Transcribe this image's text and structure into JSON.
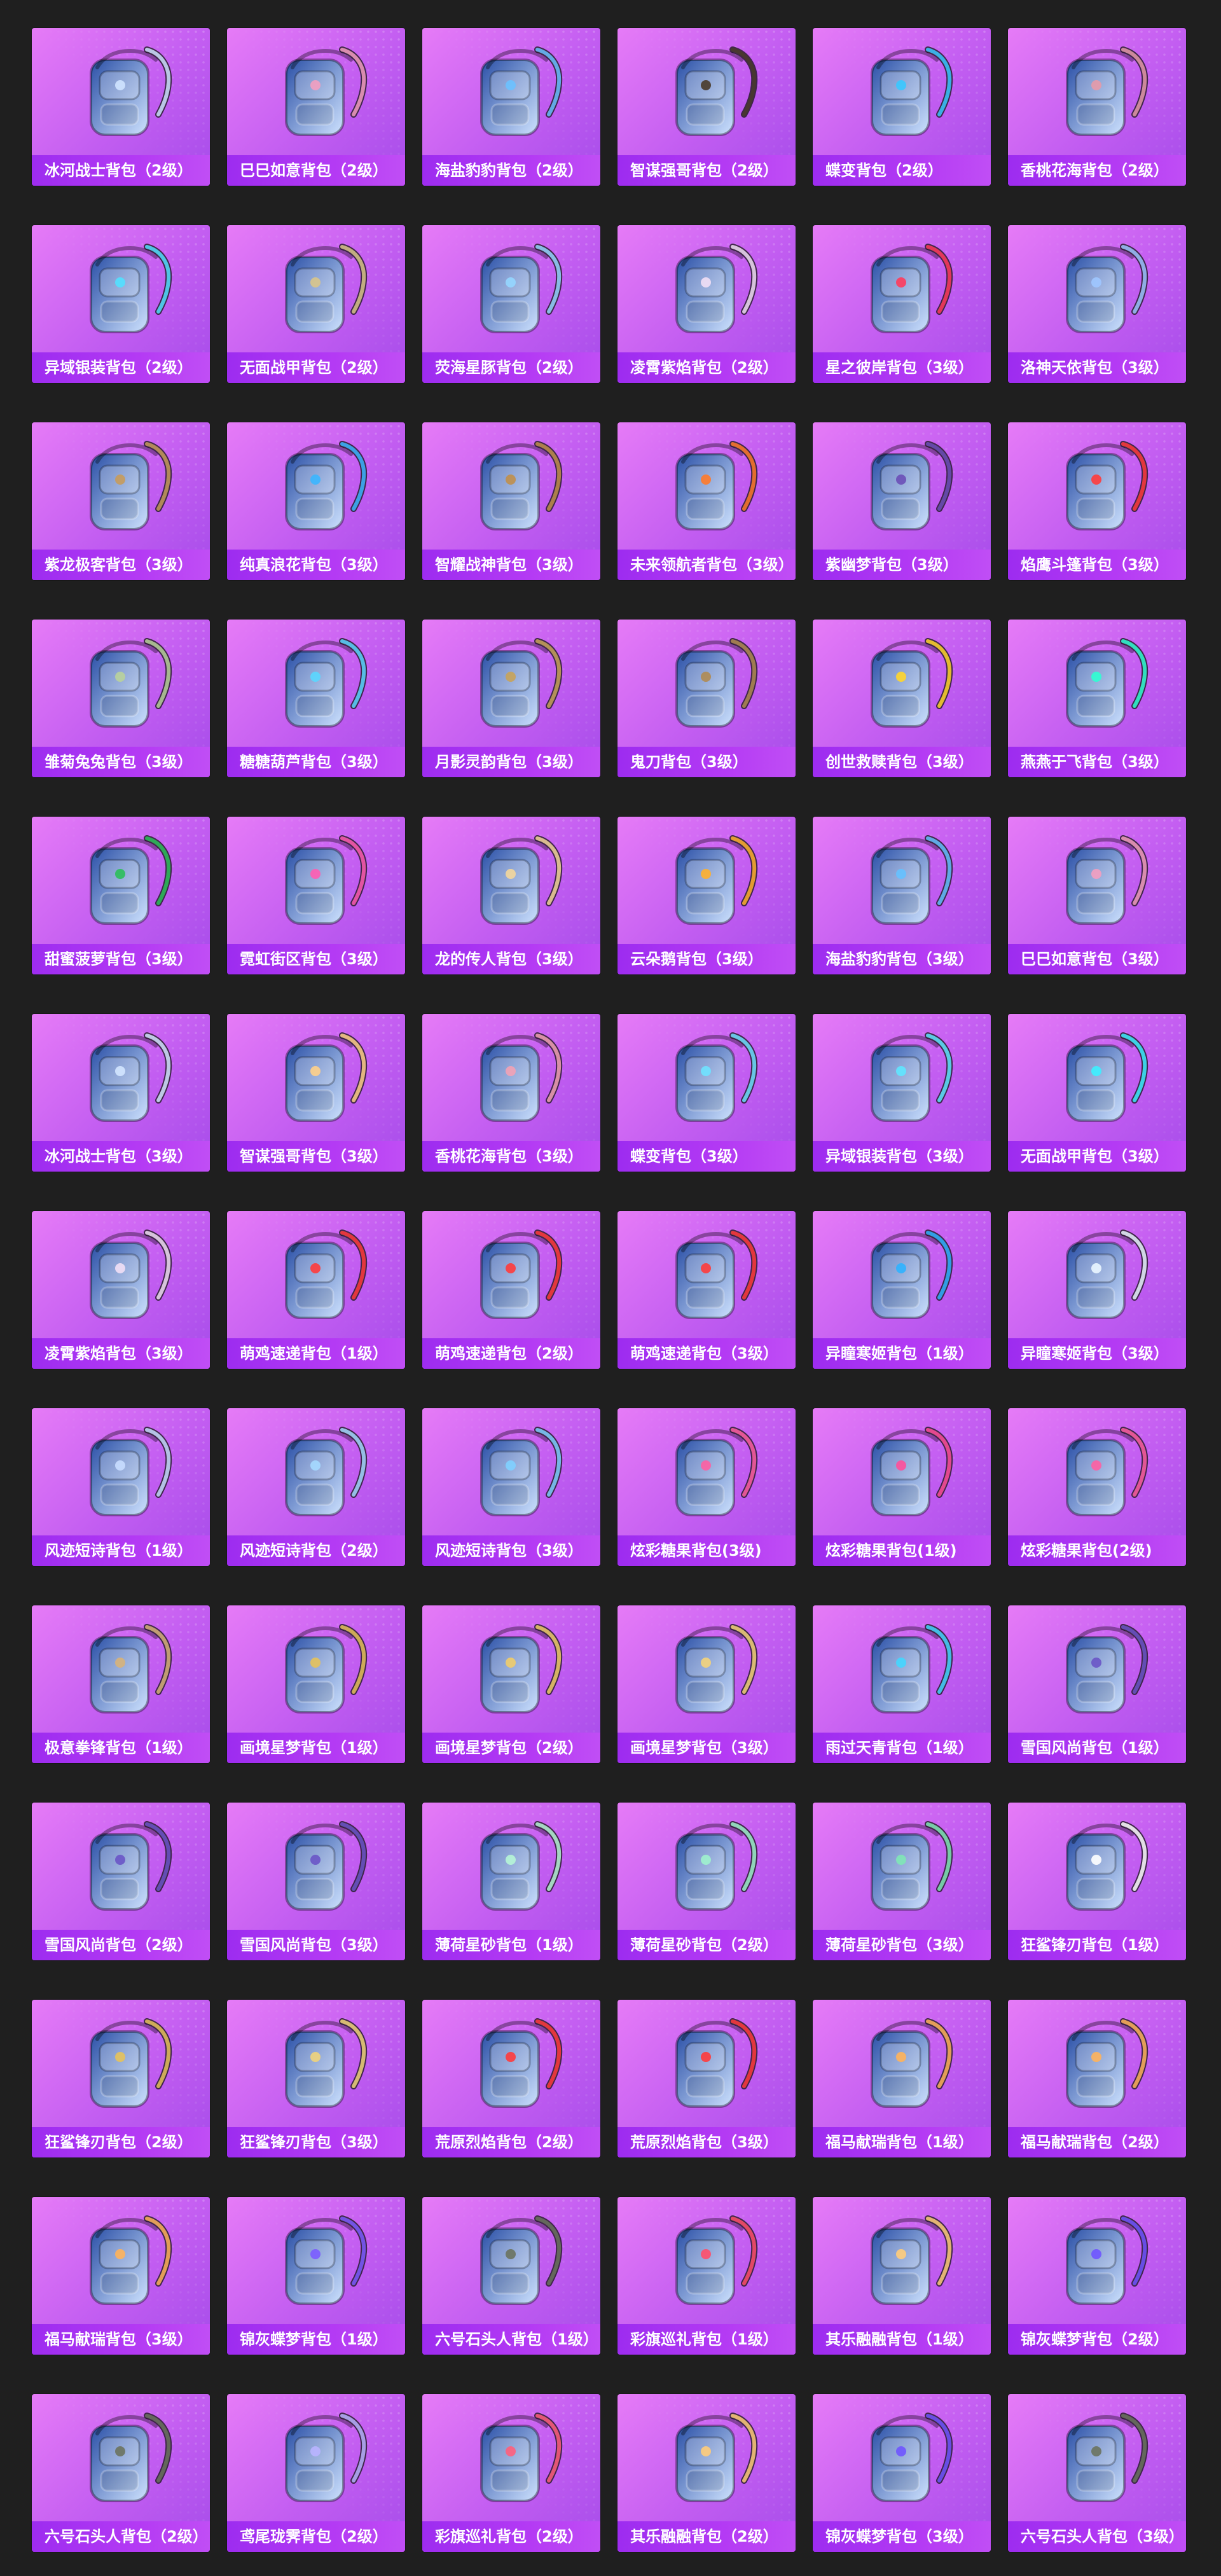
{
  "items": [
    {
      "label": "冰河战士背包（2级）",
      "icon": "backpack-icon",
      "colors": [
        "#2a4fa6",
        "#cfe3ff"
      ]
    },
    {
      "label": "巳巳如意背包（2级）",
      "icon": "backpack-icon",
      "colors": [
        "#f7e9ef",
        "#f39fc0"
      ]
    },
    {
      "label": "海盐豹豹背包（2级）",
      "icon": "backpack-icon",
      "colors": [
        "#eaf6ff",
        "#6ac1ff"
      ]
    },
    {
      "label": "智谋强哥背包（2级）",
      "icon": "backpack-icon",
      "colors": [
        "#d7a55a",
        "#4a3b2b"
      ]
    },
    {
      "label": "蝶变背包（2级）",
      "icon": "backpack-icon",
      "colors": [
        "#1d1f29",
        "#39c8ff"
      ]
    },
    {
      "label": "香桃花海背包（2级）",
      "icon": "backpack-icon",
      "colors": [
        "#fbe4ea",
        "#e59aa9"
      ]
    },
    {
      "label": "异域银装背包（2级）",
      "icon": "backpack-icon",
      "colors": [
        "#243039",
        "#52e0ff"
      ]
    },
    {
      "label": "无面战甲背包（2级）",
      "icon": "backpack-icon",
      "colors": [
        "#1b1b22",
        "#d9c58a"
      ]
    },
    {
      "label": "荧海星豚背包（2级）",
      "icon": "backpack-icon",
      "colors": [
        "#dff5ff",
        "#95d6ff"
      ]
    },
    {
      "label": "凌霄紫焰背包（2级）",
      "icon": "backpack-icon",
      "colors": [
        "#b89cc6",
        "#f1dff5"
      ]
    },
    {
      "label": "星之彼岸背包（3级）",
      "icon": "backpack-icon",
      "colors": [
        "#2b1f3f",
        "#ff3b5c"
      ]
    },
    {
      "label": "洛神天依背包（3级）",
      "icon": "backpack-icon",
      "colors": [
        "#dff3ff",
        "#9ec6ff"
      ]
    },
    {
      "label": "紫龙极客背包（3级）",
      "icon": "backpack-icon",
      "colors": [
        "#2a2222",
        "#c69b5c"
      ]
    },
    {
      "label": "纯真浪花背包（3级）",
      "icon": "backpack-icon",
      "colors": [
        "#ffe15a",
        "#3bb6ff"
      ]
    },
    {
      "label": "智耀战神背包（3级）",
      "icon": "backpack-icon",
      "colors": [
        "#f7efe4",
        "#c08f4b"
      ]
    },
    {
      "label": "未来领航者背包（3级）",
      "icon": "backpack-icon",
      "colors": [
        "#414958",
        "#ff7a2a"
      ]
    },
    {
      "label": "紫幽梦背包（3级）",
      "icon": "backpack-icon",
      "colors": [
        "#c6a8ff",
        "#6b4fb7"
      ]
    },
    {
      "label": "焰鹰斗篷背包（3级）",
      "icon": "backpack-icon",
      "colors": [
        "#3b0f18",
        "#ff3b3b"
      ]
    },
    {
      "label": "雏菊兔兔背包（3级）",
      "icon": "backpack-icon",
      "colors": [
        "#eef1df",
        "#b9d19b"
      ]
    },
    {
      "label": "糖糖葫芦背包（3级）",
      "icon": "backpack-icon",
      "colors": [
        "#ffb6b6",
        "#5ad7ff"
      ]
    },
    {
      "label": "月影灵韵背包（3级）",
      "icon": "backpack-icon",
      "colors": [
        "#e7e1d6",
        "#c8a35a"
      ]
    },
    {
      "label": "鬼刀背包（3级）",
      "icon": "backpack-icon",
      "colors": [
        "#f4ead7",
        "#b08b52"
      ]
    },
    {
      "label": "创世救赎背包（3级）",
      "icon": "backpack-icon",
      "colors": [
        "#1b1b1b",
        "#ffd52b"
      ]
    },
    {
      "label": "燕燕于飞背包（3级）",
      "icon": "backpack-icon",
      "colors": [
        "#1b1e24",
        "#2fffd2"
      ]
    },
    {
      "label": "甜蜜菠萝背包（3级）",
      "icon": "backpack-icon",
      "colors": [
        "#ffdf2e",
        "#2cbf5a"
      ]
    },
    {
      "label": "霓虹街区背包（3级）",
      "icon": "backpack-icon",
      "colors": [
        "#1b2a4a",
        "#ff5db1"
      ]
    },
    {
      "label": "龙的传人背包（3级）",
      "icon": "backpack-icon",
      "colors": [
        "#b4202c",
        "#f3d69b"
      ]
    },
    {
      "label": "云朵鹅背包（3级）",
      "icon": "backpack-icon",
      "colors": [
        "#f7f1d8",
        "#ffb02e"
      ]
    },
    {
      "label": "海盐豹豹背包（3级）",
      "icon": "backpack-icon",
      "colors": [
        "#eaf6ff",
        "#65c1ff"
      ]
    },
    {
      "label": "巳巳如意背包（3级）",
      "icon": "backpack-icon",
      "colors": [
        "#f7e9ef",
        "#f39fc0"
      ]
    },
    {
      "label": "冰河战士背包（3级）",
      "icon": "backpack-icon",
      "colors": [
        "#23449a",
        "#d3e5ff"
      ]
    },
    {
      "label": "智谋强哥背包（3级）",
      "icon": "backpack-icon",
      "colors": [
        "#c07b4b",
        "#ffd08a"
      ]
    },
    {
      "label": "香桃花海背包（3级）",
      "icon": "backpack-icon",
      "colors": [
        "#fbe4ea",
        "#f2a2b5"
      ]
    },
    {
      "label": "蝶变背包（3级）",
      "icon": "backpack-icon",
      "colors": [
        "#1d1f29",
        "#6fe2ff"
      ]
    },
    {
      "label": "异域银装背包（3级）",
      "icon": "backpack-icon",
      "colors": [
        "#243039",
        "#5fe6ff"
      ]
    },
    {
      "label": "无面战甲背包（3级）",
      "icon": "backpack-icon",
      "colors": [
        "#1b1b22",
        "#3cf0ff"
      ]
    },
    {
      "label": "凌霄紫焰背包（3级）",
      "icon": "backpack-icon",
      "colors": [
        "#b89cc6",
        "#f1dff5"
      ]
    },
    {
      "label": "萌鸡速递背包（1级）",
      "icon": "backpack-icon",
      "colors": [
        "#fff2d9",
        "#ff3b3b"
      ]
    },
    {
      "label": "萌鸡速递背包（2级）",
      "icon": "backpack-icon",
      "colors": [
        "#fff2d9",
        "#ff3b3b"
      ]
    },
    {
      "label": "萌鸡速递背包（3级）",
      "icon": "backpack-icon",
      "colors": [
        "#ffe0a3",
        "#ff3b3b"
      ]
    },
    {
      "label": "异瞳寒姬背包（1级）",
      "icon": "backpack-icon",
      "colors": [
        "#eaf6ff",
        "#2fb3ff"
      ]
    },
    {
      "label": "异瞳寒姬背包（3级）",
      "icon": "backpack-icon",
      "colors": [
        "#1c1c1c",
        "#eaf6ff"
      ]
    },
    {
      "label": "风迹短诗背包（1级）",
      "icon": "backpack-icon",
      "colors": [
        "#f7fbff",
        "#c8ddff"
      ]
    },
    {
      "label": "风迹短诗背包（2级）",
      "icon": "backpack-icon",
      "colors": [
        "#f7fbff",
        "#a5d9ff"
      ]
    },
    {
      "label": "风迹短诗背包（3级）",
      "icon": "backpack-icon",
      "colors": [
        "#f7fbff",
        "#7fd0ff"
      ]
    },
    {
      "label": "炫彩糖果背包(3级)",
      "icon": "backpack-icon",
      "colors": [
        "#f7e0c6",
        "#ff5fa2"
      ]
    },
    {
      "label": "炫彩糖果背包(1级)",
      "icon": "backpack-icon",
      "colors": [
        "#ffb07a",
        "#ff4f9a"
      ]
    },
    {
      "label": "炫彩糖果背包(2级)",
      "icon": "backpack-icon",
      "colors": [
        "#ffc08a",
        "#ff5fa2"
      ]
    },
    {
      "label": "极意拳锋背包（1级）",
      "icon": "backpack-icon",
      "colors": [
        "#fff1d8",
        "#d7b27a"
      ]
    },
    {
      "label": "画境星梦背包（1级）",
      "icon": "backpack-icon",
      "colors": [
        "#142e6a",
        "#e6c25b"
      ]
    },
    {
      "label": "画境星梦背包（2级）",
      "icon": "backpack-icon",
      "colors": [
        "#142e6a",
        "#f0cc6a"
      ]
    },
    {
      "label": "画境星梦背包（3级）",
      "icon": "backpack-icon",
      "colors": [
        "#1a2150",
        "#f4d37a"
      ]
    },
    {
      "label": "雨过天青背包（1级）",
      "icon": "backpack-icon",
      "colors": [
        "#dff9ff",
        "#44d6ff"
      ]
    },
    {
      "label": "雪国风尚背包（1级）",
      "icon": "backpack-icon",
      "colors": [
        "#ffffff",
        "#6a55c7"
      ]
    },
    {
      "label": "雪国风尚背包（2级）",
      "icon": "backpack-icon",
      "colors": [
        "#ffffff",
        "#6a55c7"
      ]
    },
    {
      "label": "雪国风尚背包（3级）",
      "icon": "backpack-icon",
      "colors": [
        "#ffffff",
        "#6a55c7"
      ]
    },
    {
      "label": "薄荷星砂背包（1级）",
      "icon": "backpack-icon",
      "colors": [
        "#e9fff4",
        "#b6f5d6"
      ]
    },
    {
      "label": "薄荷星砂背包（2级）",
      "icon": "backpack-icon",
      "colors": [
        "#e9fff4",
        "#9ff2cd"
      ]
    },
    {
      "label": "薄荷星砂背包（3级）",
      "icon": "backpack-icon",
      "colors": [
        "#e9fff4",
        "#80e7b6"
      ]
    },
    {
      "label": "狂鲨锋刃背包（1级）",
      "icon": "backpack-icon",
      "colors": [
        "#121212",
        "#ffffff"
      ]
    },
    {
      "label": "狂鲨锋刃背包（2级）",
      "icon": "backpack-icon",
      "colors": [
        "#121212",
        "#e6c25b"
      ]
    },
    {
      "label": "狂鲨锋刃背包（3级）",
      "icon": "backpack-icon",
      "colors": [
        "#121212",
        "#f0d37a"
      ]
    },
    {
      "label": "荒原烈焰背包（2级）",
      "icon": "backpack-icon",
      "colors": [
        "#2a1a22",
        "#ff3b3b"
      ]
    },
    {
      "label": "荒原烈焰背包（3级）",
      "icon": "backpack-icon",
      "colors": [
        "#3a1a22",
        "#ff3b3b"
      ]
    },
    {
      "label": "福马献瑞背包（1级）",
      "icon": "backpack-icon",
      "colors": [
        "#ff8d2a",
        "#ffb35a"
      ]
    },
    {
      "label": "福马献瑞背包（2级）",
      "icon": "backpack-icon",
      "colors": [
        "#ff8d2a",
        "#ffb35a"
      ]
    },
    {
      "label": "福马献瑞背包（3级）",
      "icon": "backpack-icon",
      "colors": [
        "#ff8d2a",
        "#ffb35a"
      ]
    },
    {
      "label": "锦灰蝶梦背包（1级）",
      "icon": "backpack-icon",
      "colors": [
        "#e7e0ff",
        "#7b5cff"
      ]
    },
    {
      "label": "六号石头人背包（1级）",
      "icon": "backpack-icon",
      "colors": [
        "#c9d0c5",
        "#6b735f"
      ]
    },
    {
      "label": "彩旗巡礼背包（1级）",
      "icon": "backpack-icon",
      "colors": [
        "#ffffff",
        "#ff4f6a"
      ]
    },
    {
      "label": "其乐融融背包（1级）",
      "icon": "backpack-icon",
      "colors": [
        "#ffffff",
        "#ffcc7a"
      ]
    },
    {
      "label": "锦灰蝶梦背包（2级）",
      "icon": "backpack-icon",
      "colors": [
        "#efeaff",
        "#6f55ff"
      ]
    },
    {
      "label": "六号石头人背包（2级）",
      "icon": "backpack-icon",
      "colors": [
        "#c9d0c5",
        "#6b735f"
      ]
    },
    {
      "label": "鸢尾珑霁背包（2级）",
      "icon": "backpack-icon",
      "colors": [
        "#f3f3ff",
        "#b9b4ff"
      ]
    },
    {
      "label": "彩旗巡礼背包（2级）",
      "icon": "backpack-icon",
      "colors": [
        "#ffffff",
        "#ff5f7c"
      ]
    },
    {
      "label": "其乐融融背包（2级）",
      "icon": "backpack-icon",
      "colors": [
        "#ffffff",
        "#ffcc7a"
      ]
    },
    {
      "label": "锦灰蝶梦背包（3级）",
      "icon": "backpack-icon",
      "colors": [
        "#efeaff",
        "#6f55ff"
      ]
    },
    {
      "label": "六号石头人背包（3级）",
      "icon": "backpack-icon",
      "colors": [
        "#c9d0c5",
        "#6b735f"
      ]
    }
  ]
}
